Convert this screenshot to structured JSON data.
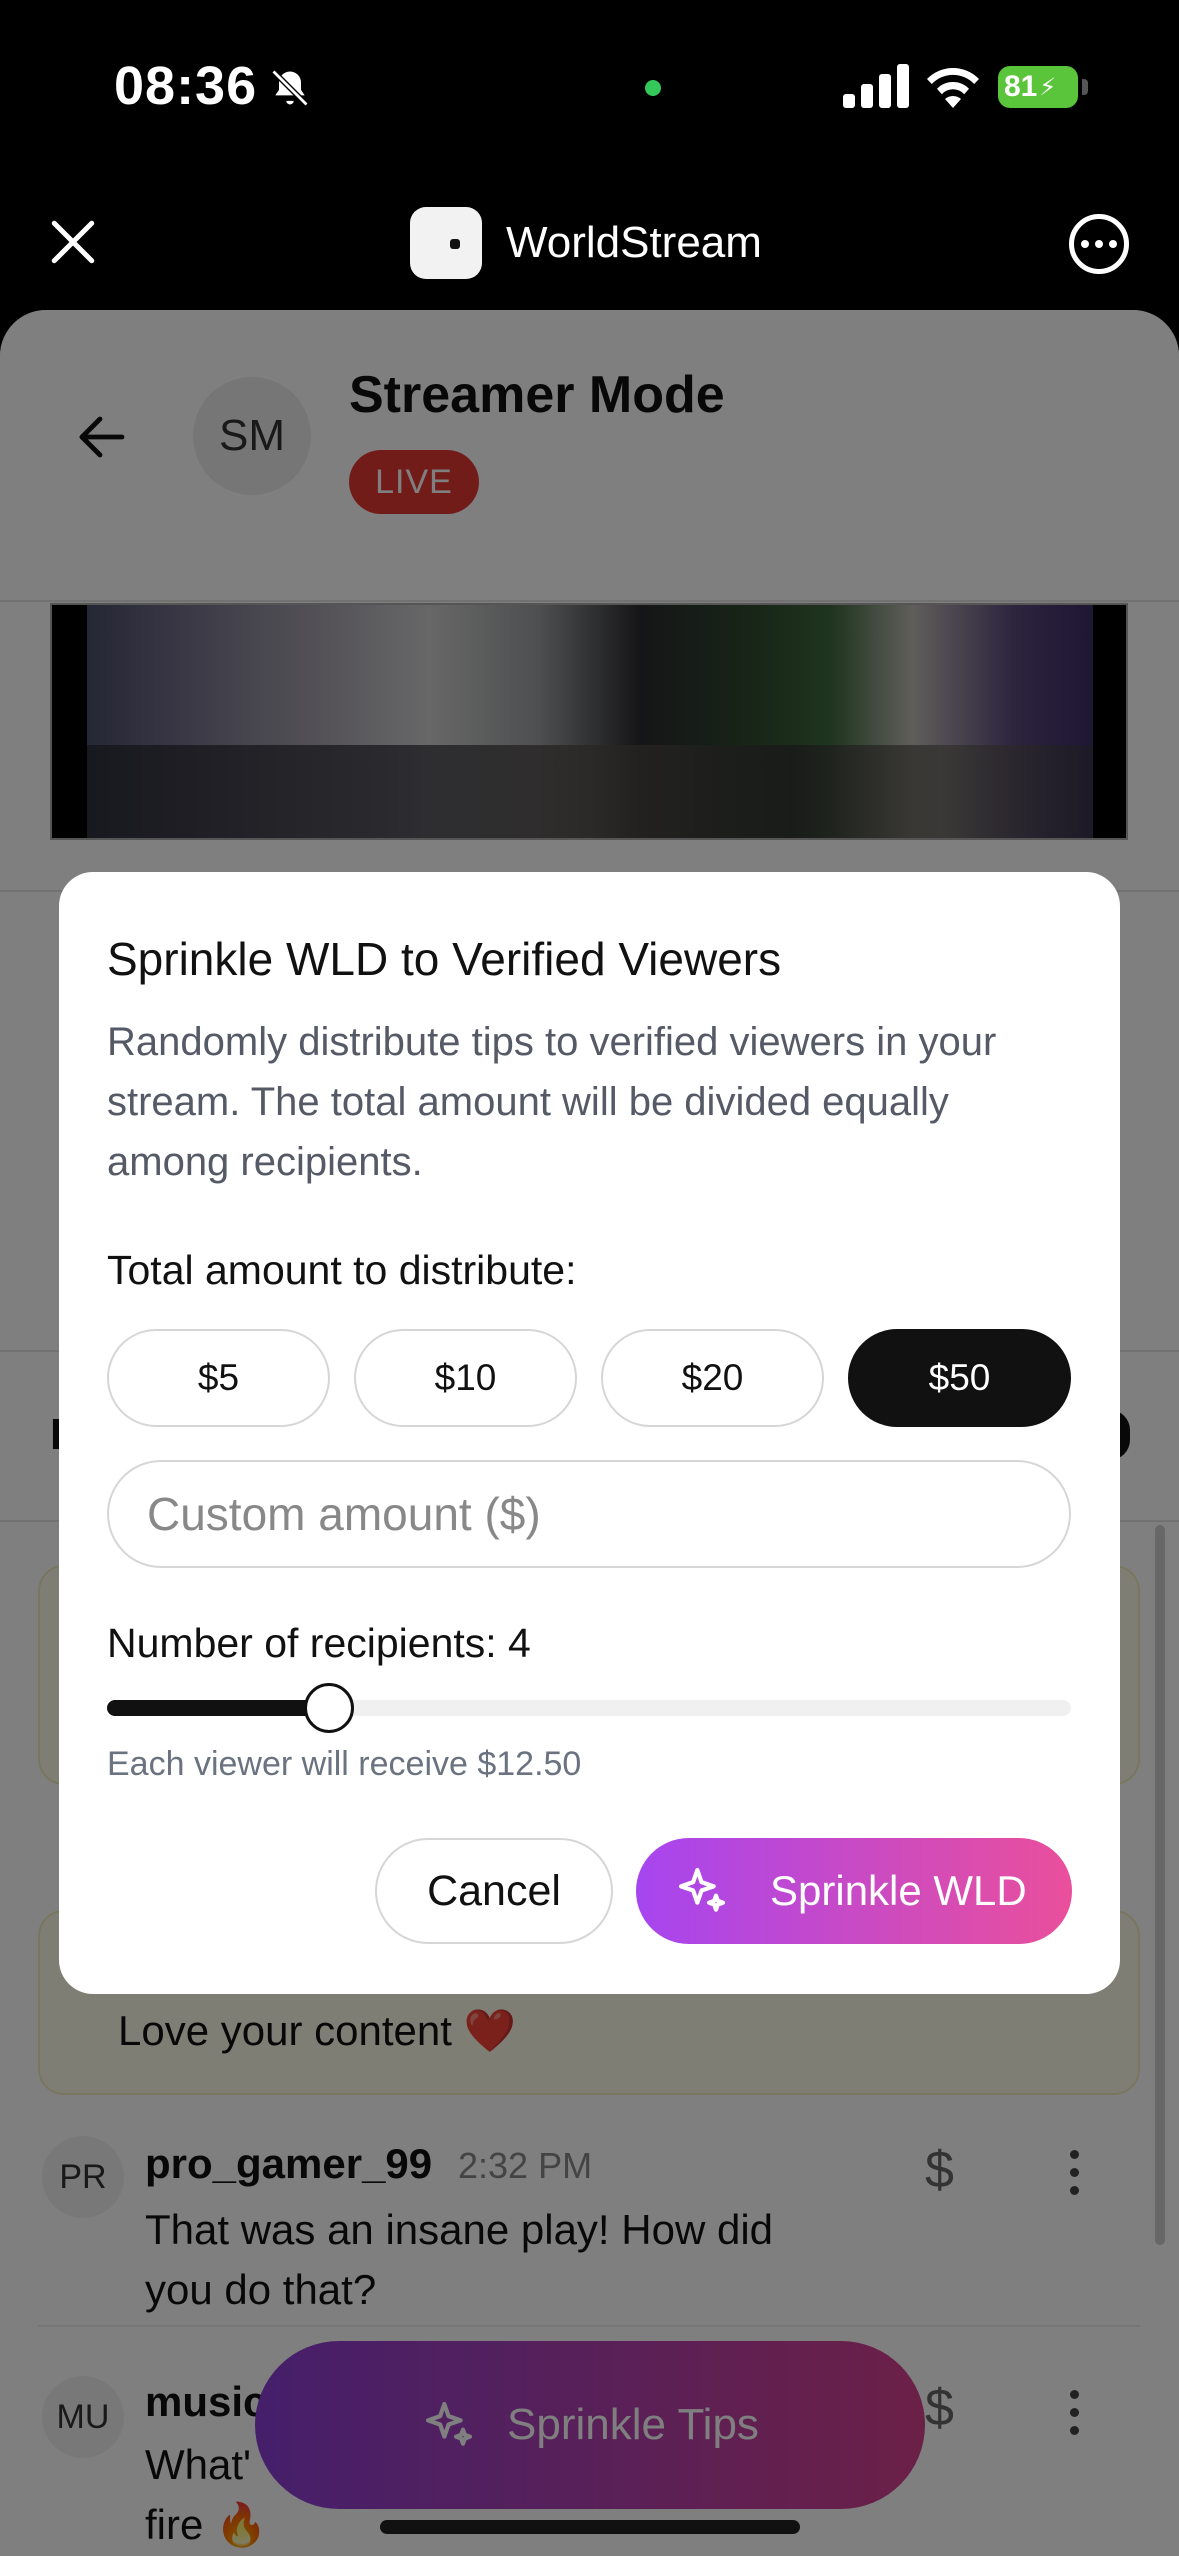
{
  "status_bar": {
    "time": "08:36",
    "battery": "81"
  },
  "app": {
    "title": "WorldStream"
  },
  "stream": {
    "avatar_initials": "SM",
    "title": "Streamer Mode",
    "live_badge": "LIVE"
  },
  "chat": {
    "header_letter": "L",
    "highlight_message": "Love your content ❤️",
    "messages": [
      {
        "initials": "PR",
        "user": "pro_gamer_99",
        "time": "2:32 PM",
        "text": "That was an insane play! How did you do that?"
      },
      {
        "initials": "MU",
        "user": "music",
        "text": "What'",
        "text2": "fire 🔥"
      }
    ],
    "tip_symbol": "$"
  },
  "sprinkle_fab": {
    "label": "Sprinkle Tips"
  },
  "modal": {
    "title": "Sprinkle WLD to Verified Viewers",
    "description": "Randomly distribute tips to verified viewers in your stream. The total amount will be divided equally among recipients.",
    "amount_label": "Total amount to distribute:",
    "amount_options": [
      "$5",
      "$10",
      "$20",
      "$50"
    ],
    "selected_amount": "$50",
    "custom_placeholder": "Custom amount ($)",
    "recipients_label": "Number of recipients: 4",
    "recipients_value": 4,
    "recipients_fill_fraction": 0.23,
    "each_receive": "Each viewer will receive $12.50",
    "cancel_label": "Cancel",
    "confirm_label": "Sprinkle WLD"
  }
}
